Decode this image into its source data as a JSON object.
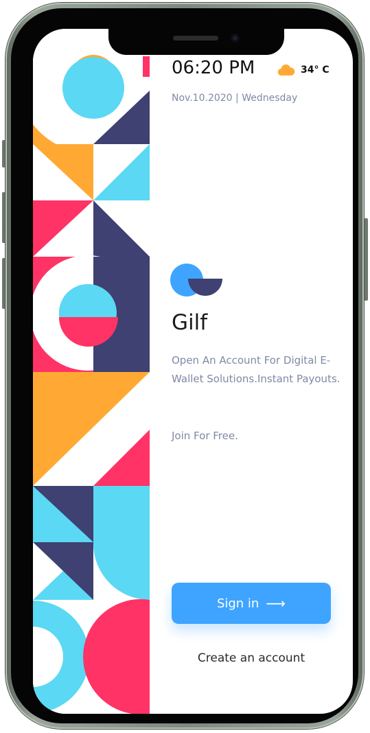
{
  "status": {
    "time": "06:20 PM",
    "temperature": "34° C",
    "weather_icon": "cloud-icon",
    "date": "Nov.10.2020 | Wednesday"
  },
  "app": {
    "name": "Gilf",
    "description": "Open An Account For Digital E-Wallet Solutions.Instant Payouts.",
    "cta": "Join For Free."
  },
  "actions": {
    "signin_label": "Sign in",
    "signin_icon": "arrow-right-icon",
    "create_label": "Create an account"
  },
  "colors": {
    "orange": "#ffa934",
    "cyan": "#5bd8f3",
    "pink": "#ff3366",
    "navy": "#3e4171",
    "blue": "#3fa4ff",
    "muted_text": "#8088a4"
  }
}
